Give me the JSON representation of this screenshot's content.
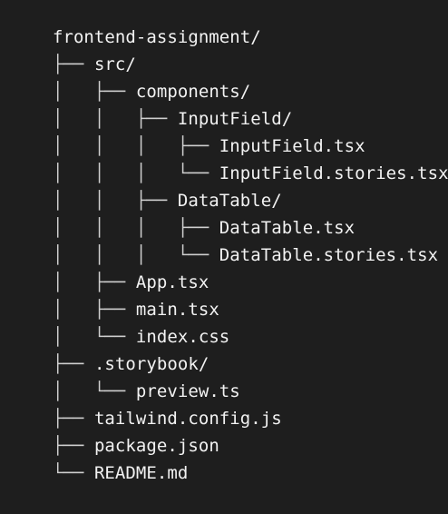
{
  "tree": {
    "lines": [
      {
        "prefix": "",
        "name": "frontend-assignment/"
      },
      {
        "prefix": "├── ",
        "name": "src/"
      },
      {
        "prefix": "│   ├── ",
        "name": "components/"
      },
      {
        "prefix": "│   │   ├── ",
        "name": "InputField/"
      },
      {
        "prefix": "│   │   │   ├── ",
        "name": "InputField.tsx"
      },
      {
        "prefix": "│   │   │   └── ",
        "name": "InputField.stories.tsx"
      },
      {
        "prefix": "│   │   ├── ",
        "name": "DataTable/"
      },
      {
        "prefix": "│   │   │   ├── ",
        "name": "DataTable.tsx"
      },
      {
        "prefix": "│   │   │   └── ",
        "name": "DataTable.stories.tsx"
      },
      {
        "prefix": "│   ├── ",
        "name": "App.tsx"
      },
      {
        "prefix": "│   ├── ",
        "name": "main.tsx"
      },
      {
        "prefix": "│   └── ",
        "name": "index.css"
      },
      {
        "prefix": "├── ",
        "name": ".storybook/"
      },
      {
        "prefix": "│   └── ",
        "name": "preview.ts"
      },
      {
        "prefix": "├── ",
        "name": "tailwind.config.js"
      },
      {
        "prefix": "├── ",
        "name": "package.json"
      },
      {
        "prefix": "└── ",
        "name": "README.md"
      }
    ]
  },
  "colors": {
    "background": "#1e1e1e",
    "text": "#f2f2f2",
    "guides": "#cfcfcf"
  }
}
